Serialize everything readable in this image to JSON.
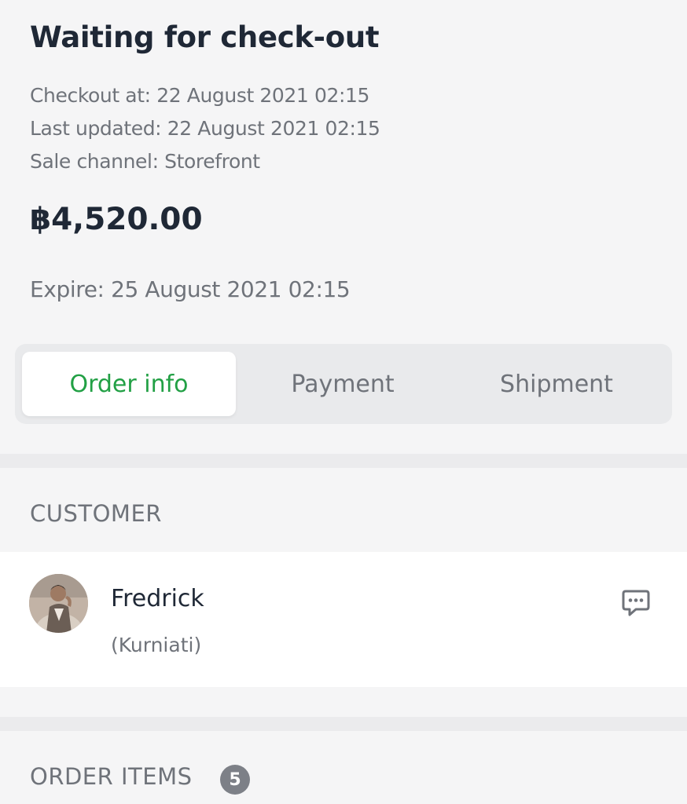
{
  "order": {
    "status_title": "Waiting for check-out",
    "checkout_at": "Checkout at: 22 August 2021 02:15",
    "last_updated": "Last updated: 22 August 2021 02:15",
    "sale_channel": "Sale channel: Storefront",
    "total": "฿4,520.00",
    "expire": "Expire: 25 August 2021 02:15"
  },
  "tabs": [
    {
      "label": "Order info",
      "active": true
    },
    {
      "label": "Payment",
      "active": false
    },
    {
      "label": "Shipment",
      "active": false
    }
  ],
  "customer_section": {
    "heading": "CUSTOMER",
    "name": "Fredrick",
    "alias": "(Kurniati)",
    "chat_icon": "chat-bubble-icon"
  },
  "order_items_section": {
    "heading": "ORDER ITEMS",
    "count": "5"
  },
  "colors": {
    "accent_green": "#22a045",
    "text_dark": "#1f2836",
    "text_muted": "#6f737a",
    "background": "#f5f5f6",
    "badge": "#7d8087"
  }
}
